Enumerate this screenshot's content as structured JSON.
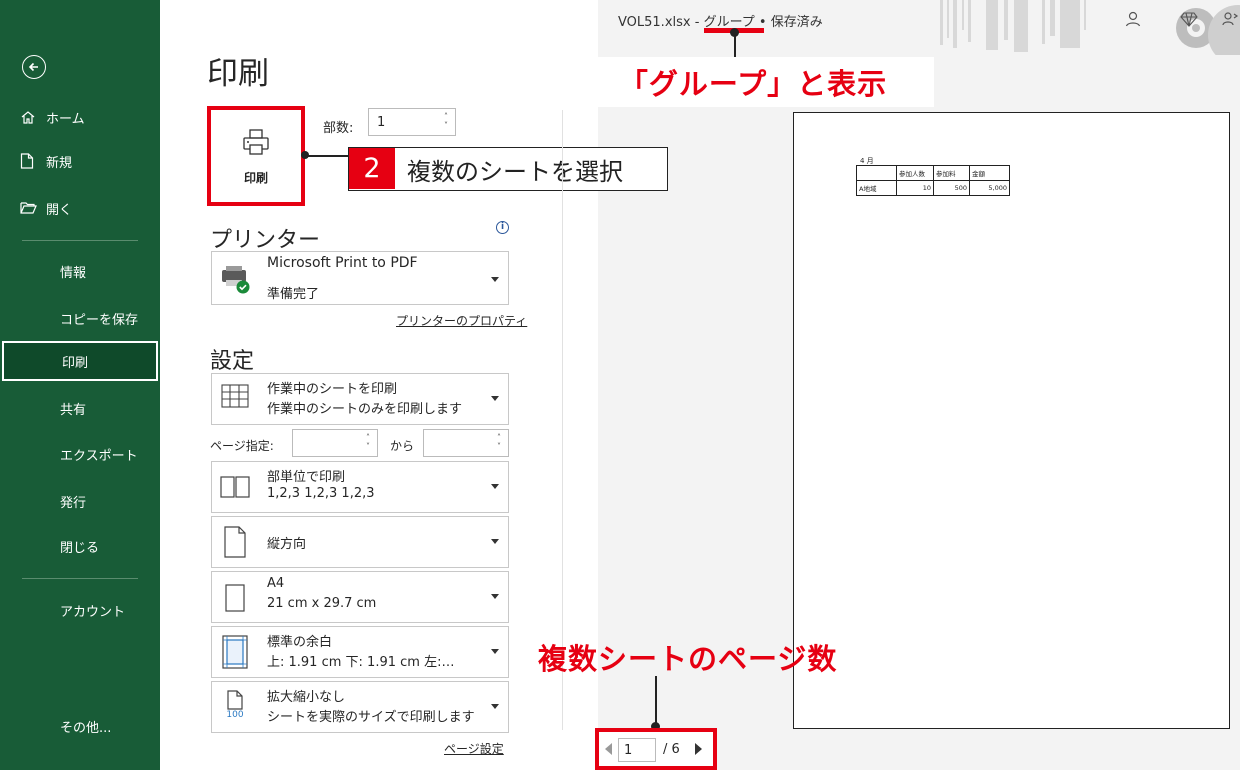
{
  "window": {
    "file": "VOL51.xlsx",
    "sep1": " - ",
    "group": "グループ",
    "sep2": " • ",
    "status": "保存済み"
  },
  "sidebar": {
    "items": [
      {
        "label": "ホーム",
        "icon": "home-icon"
      },
      {
        "label": "新規",
        "icon": "new-document-icon"
      },
      {
        "label": "開く",
        "icon": "open-folder-icon"
      },
      {
        "label": "情報"
      },
      {
        "label": "コピーを保存"
      },
      {
        "label": "印刷",
        "active": true
      },
      {
        "label": "共有"
      },
      {
        "label": "エクスポート"
      },
      {
        "label": "発行"
      },
      {
        "label": "閉じる"
      },
      {
        "label": "アカウント"
      },
      {
        "label": "その他..."
      }
    ]
  },
  "print": {
    "title": "印刷",
    "button_label": "印刷",
    "copies_label": "部数:",
    "copies_value": "1"
  },
  "printer": {
    "section_title": "プリンター",
    "name": "Microsoft Print to PDF",
    "status": "準備完了",
    "properties_link": "プリンターのプロパティ"
  },
  "settings": {
    "section_title": "設定",
    "what": {
      "title": "作業中のシートを印刷",
      "sub": "作業中のシートのみを印刷します"
    },
    "pages_label": "ページ指定:",
    "pages_to": "から",
    "collate": {
      "title": "部単位で印刷",
      "sub": "1,2,3    1,2,3    1,2,3"
    },
    "orientation": {
      "title": "縦方向"
    },
    "paper": {
      "title": "A4",
      "sub": "21 cm x 29.7 cm"
    },
    "margins": {
      "title": "標準の余白",
      "sub": "上: 1.91 cm 下: 1.91 cm 左:…"
    },
    "scaling": {
      "title": "拡大縮小なし",
      "sub": "シートを実際のサイズで印刷します",
      "icon_text": "100"
    },
    "page_setup_link": "ページ設定"
  },
  "preview": {
    "sheet_title": "4 月",
    "headers": [
      "",
      "参加人数",
      "参加料",
      "金額"
    ],
    "row": [
      "A地域",
      "10",
      "500",
      "5,000"
    ],
    "pager": {
      "current": "1",
      "total": "/ 6"
    }
  },
  "annotations": {
    "group_label": "「グループ」と表示",
    "step_number": "2",
    "step_text": "複数のシートを選択",
    "pages_label": "複数シートのページ数"
  },
  "colors": {
    "sidebar": "#185c37",
    "highlight": "#e60012"
  }
}
